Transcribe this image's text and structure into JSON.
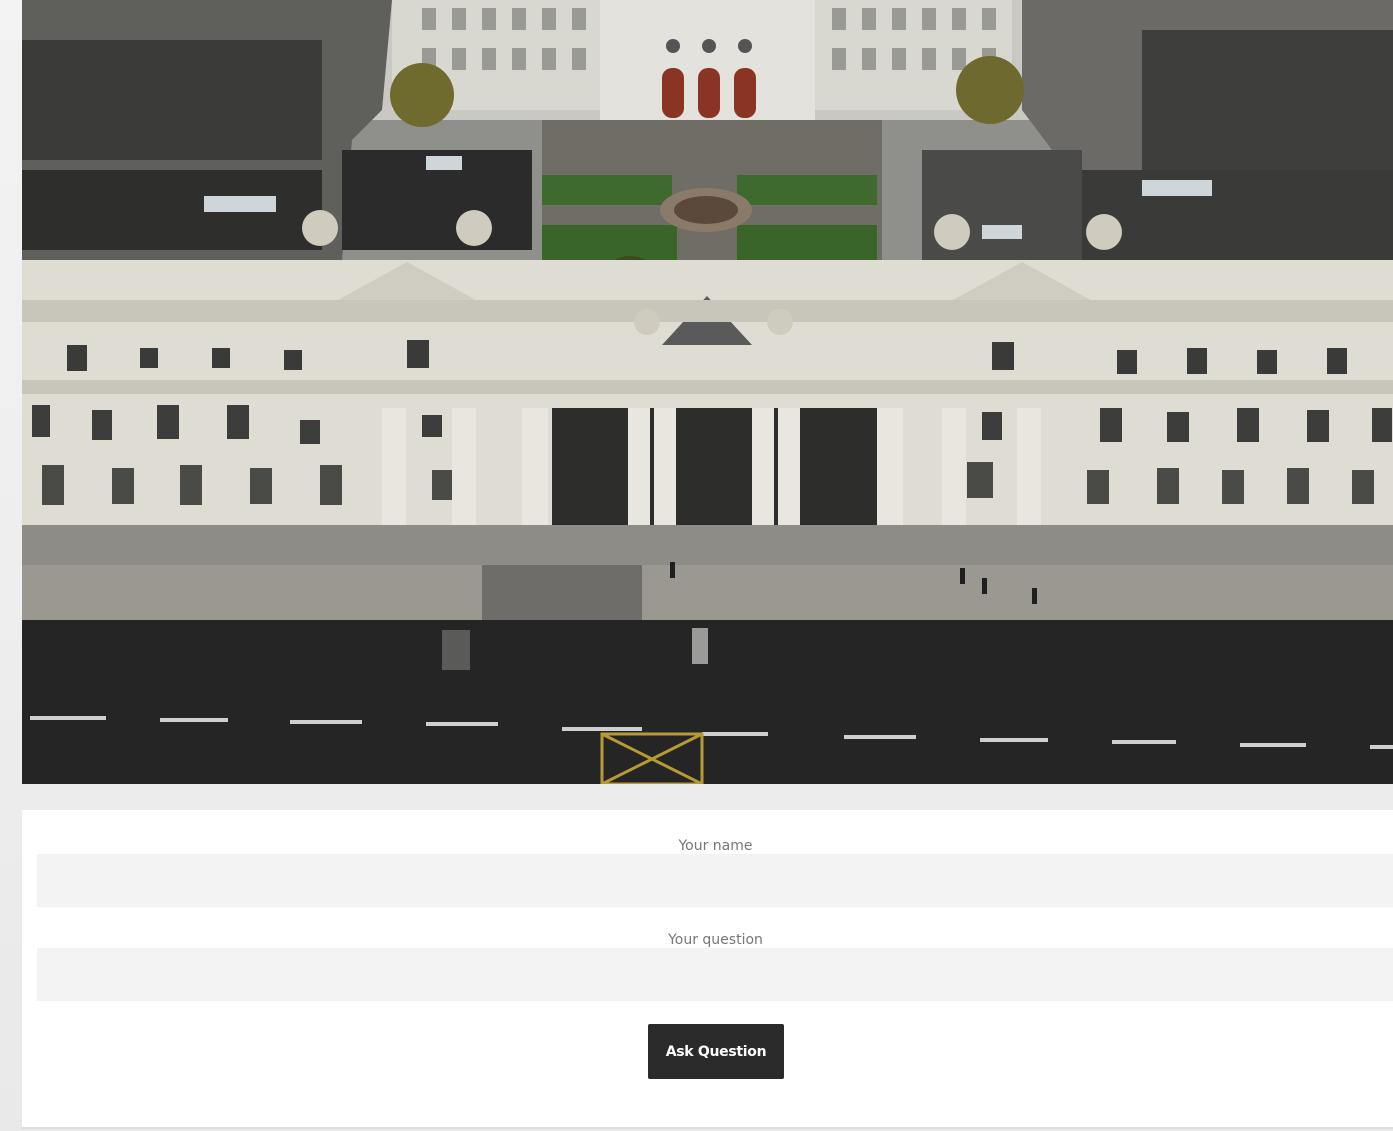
{
  "hero_image": {
    "description_icon": "building-photo"
  },
  "form": {
    "name_label": "Your name",
    "name_value": "",
    "question_label": "Your question",
    "question_value": "",
    "submit_label": "Ask Question"
  },
  "colors": {
    "button_bg": "#2b2b2b",
    "input_bg": "#f3f3f3",
    "card_bg": "#ffffff"
  }
}
